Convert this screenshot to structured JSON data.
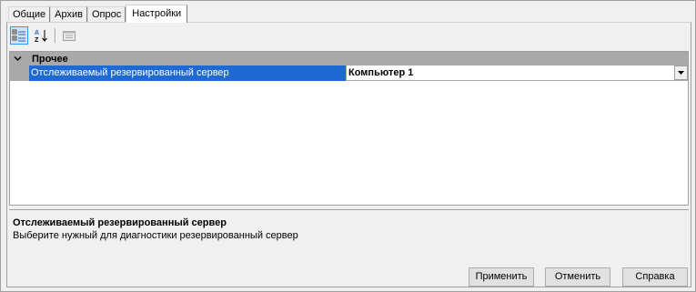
{
  "tabs": [
    {
      "label": "Общие"
    },
    {
      "label": "Архив"
    },
    {
      "label": "Опрос"
    },
    {
      "label": "Настройки"
    }
  ],
  "active_tab": "Настройки",
  "toolbar": {
    "buttons": [
      {
        "icon": "categorized-view-icon",
        "pressed": true
      },
      {
        "icon": "sort-alphabetical-icon",
        "pressed": false
      },
      {
        "icon": "property-pages-icon",
        "pressed": false,
        "disabled": true
      }
    ]
  },
  "property_grid": {
    "category": {
      "label": "Прочее",
      "expanded": true
    },
    "properties": [
      {
        "name": "Отслеживаемый резервированный сервер",
        "value": "Компьютер 1",
        "selected": true
      }
    ]
  },
  "description": {
    "title": "Отслеживаемый резервированный сервер",
    "text": "Выберите нужный для диагностики резервированный сервер"
  },
  "buttons": {
    "apply": "Применить",
    "cancel": "Отменить",
    "help": "Справка"
  },
  "colors": {
    "selection": "#1f69d2",
    "category_bg": "#a9a9a9",
    "window_bg": "#f0f0f0"
  }
}
